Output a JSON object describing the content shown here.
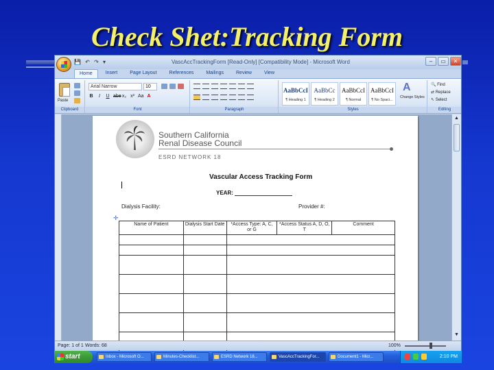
{
  "slide": {
    "title": "Check Shet:Tracking Form"
  },
  "window": {
    "title": "VascAccTrackingForm [Read-Only] [Compatibility Mode] - Microsoft Word",
    "controls": [
      "–",
      "▭",
      "✕"
    ]
  },
  "ribbon": {
    "tabs": [
      "Home",
      "Insert",
      "Page Layout",
      "References",
      "Mailings",
      "Review",
      "View"
    ],
    "clipboard": {
      "paste_label": "Paste",
      "group_label": "Clipboard"
    },
    "font": {
      "name": "Arial Narrow",
      "size": "10",
      "group_label": "Font",
      "buttons": [
        "B",
        "I",
        "U",
        "abe",
        "x₂",
        "x²",
        "Aa",
        "A"
      ]
    },
    "paragraph": {
      "group_label": "Paragraph"
    },
    "styles": {
      "group_label": "Styles",
      "tiles": [
        {
          "sample": "AaBbCcI",
          "name": "¶ Heading 1"
        },
        {
          "sample": "AaBbCc",
          "name": "¶ Heading 2"
        },
        {
          "sample": "AaBbCcI",
          "name": "¶ Normal"
        },
        {
          "sample": "AaBbCcI",
          "name": "¶ No Spaci..."
        }
      ],
      "change_styles": "Change Styles"
    },
    "editing": {
      "group_label": "Editing",
      "find": "Find",
      "replace": "Replace",
      "select": "Select"
    }
  },
  "document": {
    "org_name_line1": "Southern California",
    "org_name_line2": "Renal Disease Council",
    "network": "ESRD NETWORK 18",
    "form_title": "Vascular Access Tracking Form",
    "year_label": "YEAR:",
    "facility_label": "Dialysis Facility:",
    "provider_label": "Provider #:",
    "table_headers": [
      "Name of Patient",
      "Dialysis Start Date",
      "*Access Type: A, C, or G",
      "*Access Status A, D, O, T",
      "Comment"
    ]
  },
  "status": {
    "page": "Page: 1 of 1",
    "words": "Words: 68",
    "zoom": "100%"
  },
  "taskbar": {
    "start": "start",
    "items": [
      "Inbox - Microsoft O...",
      "Minutes-Checklist...",
      "ESRD Network 18...",
      "VascAccTrackingFor...",
      "Document1 - Micr..."
    ],
    "clock": "2:10 PM"
  }
}
